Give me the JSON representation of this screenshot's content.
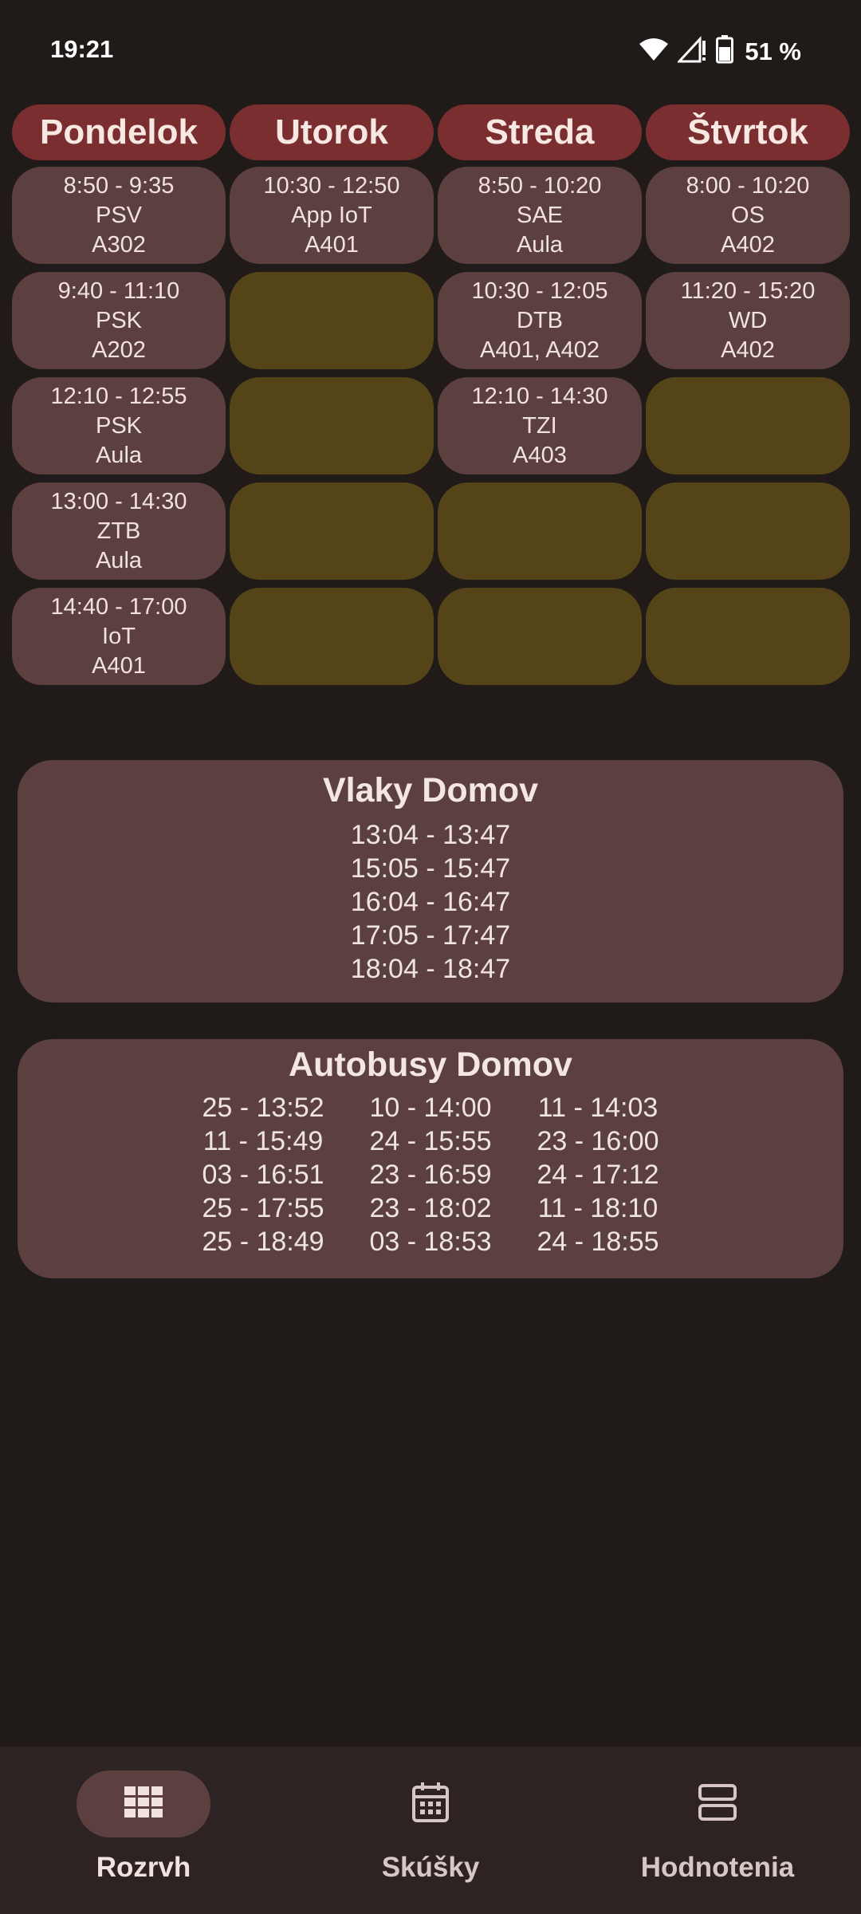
{
  "status_bar": {
    "time": "19:21",
    "battery": "51 %"
  },
  "schedule": {
    "days": [
      "Pondelok",
      "Utorok",
      "Streda",
      "Štvrtok"
    ],
    "rows": [
      [
        {
          "time": "8:50 - 9:35",
          "subject": "PSV",
          "room": "A302"
        },
        {
          "time": "10:30 - 12:50",
          "subject": "App IoT",
          "room": "A401"
        },
        {
          "time": "8:50 - 10:20",
          "subject": "SAE",
          "room": "Aula"
        },
        {
          "time": "8:00 - 10:20",
          "subject": "OS",
          "room": "A402"
        }
      ],
      [
        {
          "time": "9:40 - 11:10",
          "subject": "PSK",
          "room": "A202"
        },
        {
          "time": "",
          "subject": "",
          "room": ""
        },
        {
          "time": "10:30 - 12:05",
          "subject": "DTB",
          "room": "A401, A402"
        },
        {
          "time": "11:20 - 15:20",
          "subject": "WD",
          "room": "A402"
        }
      ],
      [
        {
          "time": "12:10 - 12:55",
          "subject": "PSK",
          "room": "Aula"
        },
        {
          "time": "",
          "subject": "",
          "room": ""
        },
        {
          "time": "12:10 - 14:30",
          "subject": "TZI",
          "room": "A403"
        },
        {
          "time": "",
          "subject": "",
          "room": ""
        }
      ],
      [
        {
          "time": "13:00 - 14:30",
          "subject": "ZTB",
          "room": "Aula"
        },
        {
          "time": "",
          "subject": "",
          "room": ""
        },
        {
          "time": "",
          "subject": "",
          "room": ""
        },
        {
          "time": "",
          "subject": "",
          "room": ""
        }
      ],
      [
        {
          "time": "14:40 - 17:00",
          "subject": "IoT",
          "room": "A401"
        },
        {
          "time": "",
          "subject": "",
          "room": ""
        },
        {
          "time": "",
          "subject": "",
          "room": ""
        },
        {
          "time": "",
          "subject": "",
          "room": ""
        }
      ]
    ]
  },
  "trains": {
    "title": "Vlaky Domov",
    "times": [
      "13:04 - 13:47",
      "15:05 - 15:47",
      "16:04 - 16:47",
      "17:05 - 17:47",
      "18:04 - 18:47"
    ]
  },
  "buses": {
    "title": "Autobusy Domov",
    "entries": [
      "25 - 13:52",
      "10 - 14:00",
      "11 - 14:03",
      "11 - 15:49",
      "24 - 15:55",
      "23 - 16:00",
      "03 - 16:51",
      "23 - 16:59",
      "24 - 17:12",
      "25 - 17:55",
      "23 - 18:02",
      "11 - 18:10",
      "25 - 18:49",
      "03 - 18:53",
      "24 - 18:55"
    ]
  },
  "nav": {
    "items": [
      {
        "label": "Rozrvh",
        "icon": "grid-icon"
      },
      {
        "label": "Skúšky",
        "icon": "calendar-icon"
      },
      {
        "label": "Hodnotenia",
        "icon": "list-icon"
      }
    ]
  },
  "colors": {
    "background": "#201b19",
    "day_header": "#7b2e2f",
    "lesson_cell": "#5c4040",
    "empty_cell": "#564419",
    "nav_bar": "#2d2322"
  }
}
